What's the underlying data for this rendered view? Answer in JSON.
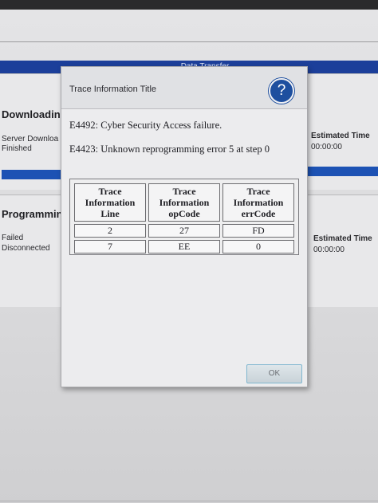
{
  "app": {
    "window_title": "Data Transfer"
  },
  "background": {
    "download": {
      "title": "Downloading",
      "status_line1": "Server Downloa",
      "status_line2": "Finished",
      "estimated_label": "Estimated Time",
      "estimated_value": "00:00:00"
    },
    "programming": {
      "title": "Programmin",
      "status_line1": "Failed",
      "status_line2": "Disconnected",
      "estimated_label": "Estimated Time",
      "estimated_value": "00:00:00"
    }
  },
  "dialog": {
    "title": "Trace Information Title",
    "help_label": "?",
    "errors": [
      "E4492: Cyber Security Access failure.",
      "E4423: Unknown reprogramming error 5 at step 0"
    ],
    "table": {
      "headers": [
        [
          "Trace",
          "Information",
          "Line"
        ],
        [
          "Trace",
          "Information",
          "opCode"
        ],
        [
          "Trace",
          "Information",
          "errCode"
        ]
      ],
      "rows": [
        [
          "2",
          "27",
          "FD"
        ],
        [
          "7",
          "EE",
          "0"
        ]
      ]
    },
    "ok_label": "OK"
  },
  "colors": {
    "accent_band": "#1c3f9a",
    "help_button": "#1e4f9f",
    "progress_bar": "#1d52b4"
  }
}
